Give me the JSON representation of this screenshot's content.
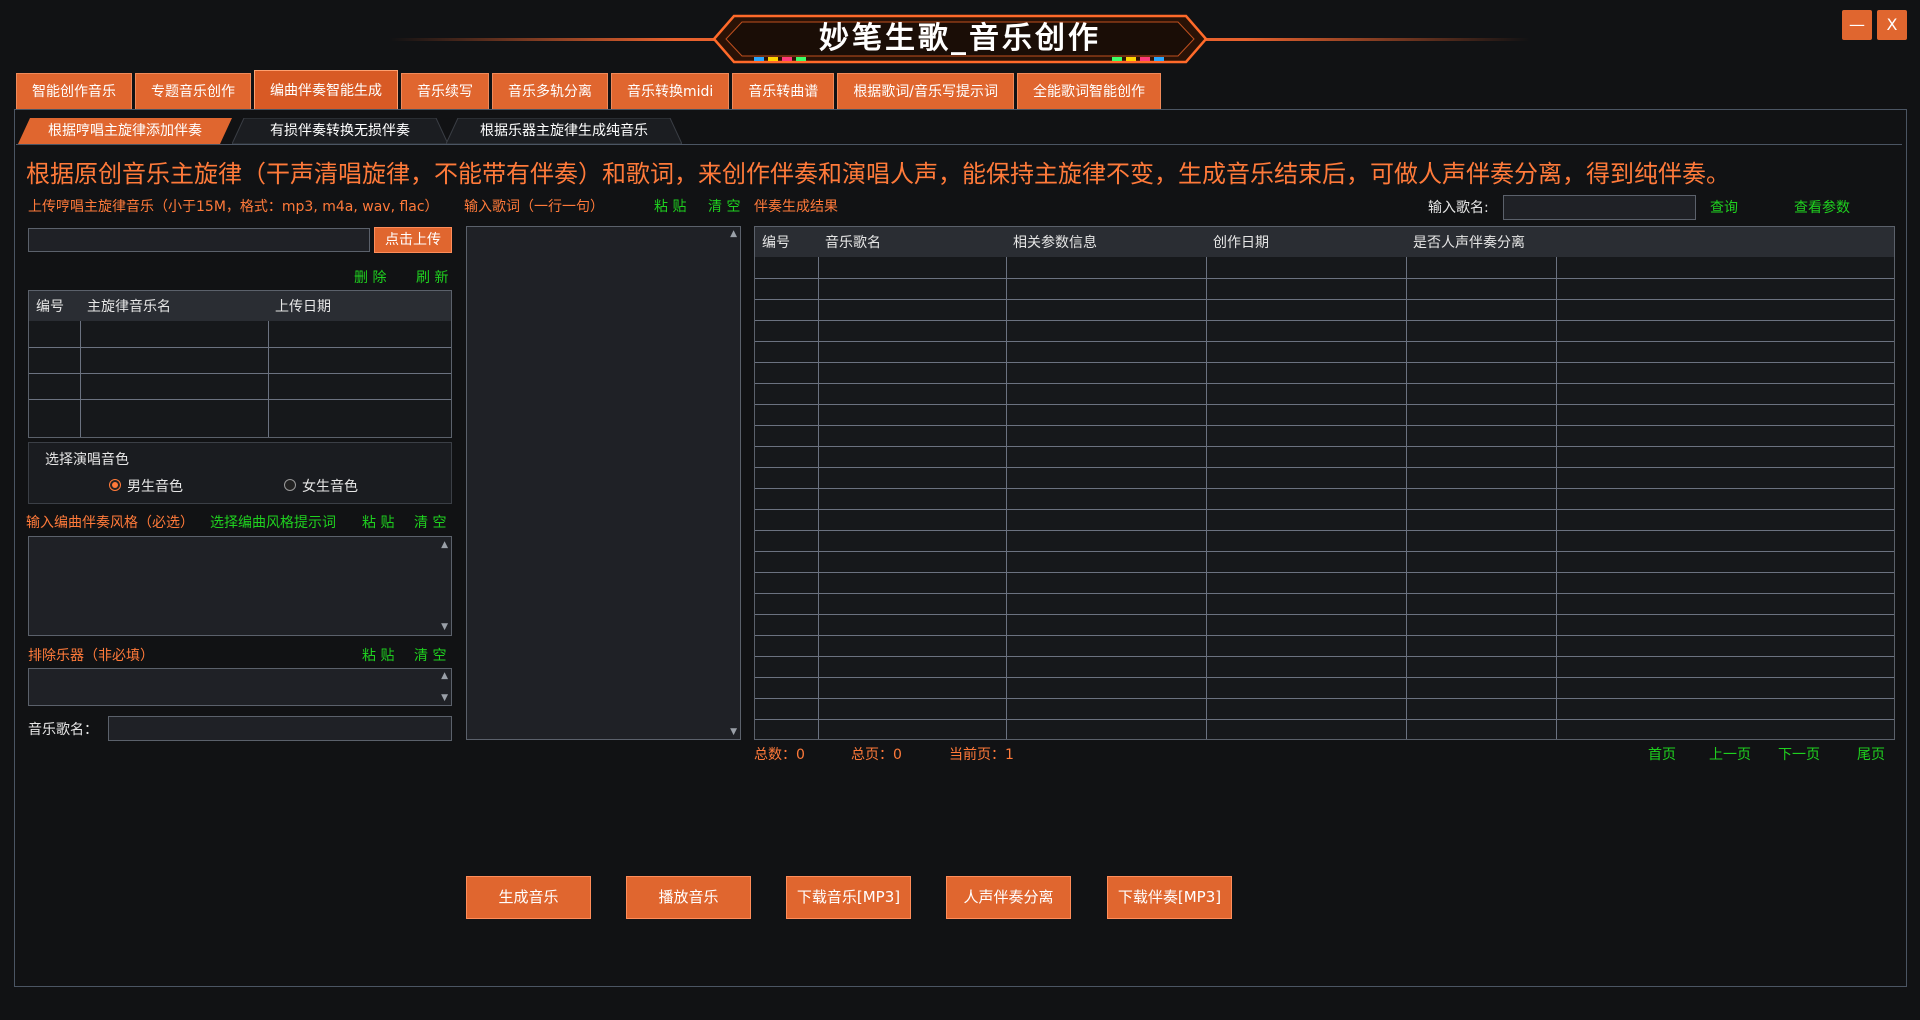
{
  "app": {
    "title": "妙笔生歌_音乐创作",
    "minimize_icon": "—",
    "close_icon": "X"
  },
  "tabs": [
    {
      "label": "智能创作音乐"
    },
    {
      "label": "专题音乐创作"
    },
    {
      "label": "编曲伴奏智能生成"
    },
    {
      "label": "音乐续写"
    },
    {
      "label": "音乐多轨分离"
    },
    {
      "label": "音乐转换midi"
    },
    {
      "label": "音乐转曲谱"
    },
    {
      "label": "根据歌词/音乐写提示词"
    },
    {
      "label": "全能歌词智能创作"
    }
  ],
  "subtabs": [
    {
      "label": "根据哼唱主旋律添加伴奏"
    },
    {
      "label": "有损伴奏转换无损伴奏"
    },
    {
      "label": "根据乐器主旋律生成纯音乐"
    }
  ],
  "description": "根据原创音乐主旋律（干声清唱旋律，不能带有伴奏）和歌词，来创作伴奏和演唱人声，能保持主旋律不变，生成音乐结束后，可做人声伴奏分离，得到纯伴奏。",
  "upload": {
    "label": "上传哼唱主旋律音乐（小于15M，格式：mp3, m4a, wav, flac）",
    "path_value": "",
    "button": "点击上传",
    "delete": "删 除",
    "refresh": "刷 新",
    "columns": [
      "编号",
      "主旋律音乐名",
      "上传日期"
    ]
  },
  "voice": {
    "group_label": "选择演唱音色",
    "male": "男生音色",
    "female": "女生音色",
    "selected": "male"
  },
  "style": {
    "label": "输入编曲伴奏风格（必选）",
    "choose": "选择编曲风格提示词",
    "paste": "粘 贴",
    "clear": "清 空",
    "value": ""
  },
  "exclude": {
    "label": "排除乐器（非必填）",
    "paste": "粘 贴",
    "clear": "清 空",
    "value": ""
  },
  "song_name": {
    "label": "音乐歌名：",
    "value": ""
  },
  "lyrics": {
    "label": "输入歌词（一行一句）",
    "paste": "粘 贴",
    "clear": "清 空",
    "value": ""
  },
  "results": {
    "label": "伴奏生成结果",
    "search_label": "输入歌名:",
    "search_value": "",
    "query": "查询",
    "view_params": "查看参数",
    "columns": [
      "编号",
      "音乐歌名",
      "相关参数信息",
      "创作日期",
      "是否人声伴奏分离"
    ]
  },
  "pager": {
    "total": "总数：0",
    "pages": "总页：0",
    "current": "当前页：1",
    "first": "首页",
    "prev": "上一页",
    "next": "下一页",
    "last": "尾页"
  },
  "actions": {
    "generate": "生成音乐",
    "play": "播放音乐",
    "download_music": "下载音乐[MP3]",
    "separate": "人声伴奏分离",
    "download_accomp": "下载伴奏[MP3]"
  },
  "colors": {
    "accent": "#e0662f",
    "accent_text": "#ff7a3a",
    "green": "#1fd11f",
    "background": "#111214"
  }
}
